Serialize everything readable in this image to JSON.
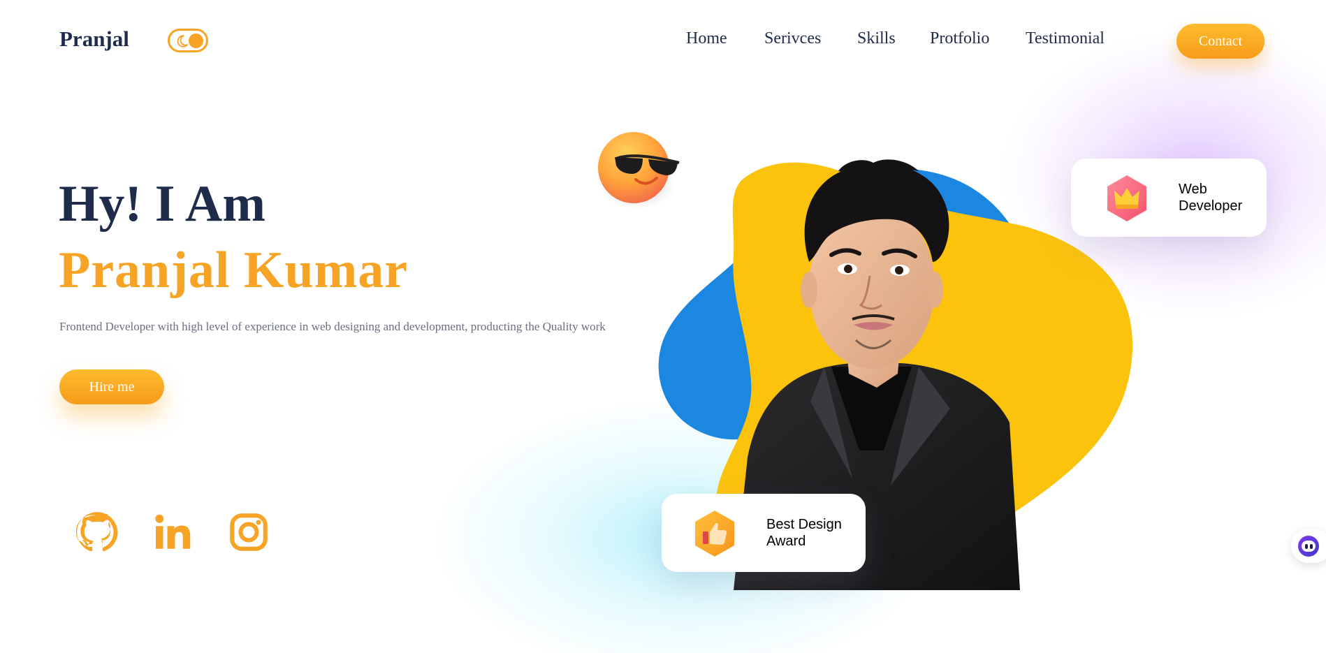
{
  "header": {
    "brand": "Pranjal",
    "nav": [
      "Home",
      "Serivces",
      "Skills",
      "Protfolio",
      "Testimonial"
    ],
    "contact_label": "Contact"
  },
  "hero": {
    "greeting": "Hy! I Am",
    "name": "Pranjal Kumar",
    "description": "Frontend Developer with high level of experience in web designing and development, producting the Quality work",
    "hire_label": "Hire me"
  },
  "cards": {
    "web_developer": [
      "Web",
      "Developer"
    ],
    "award": [
      "Best Design",
      "Award"
    ]
  },
  "socials": [
    "github-icon",
    "linkedin-icon",
    "instagram-icon"
  ],
  "colors": {
    "accent": "#f7a325",
    "dark": "#1e2b4a",
    "blob_yellow": "#fcc30d",
    "blob_blue": "#1b87e0"
  }
}
